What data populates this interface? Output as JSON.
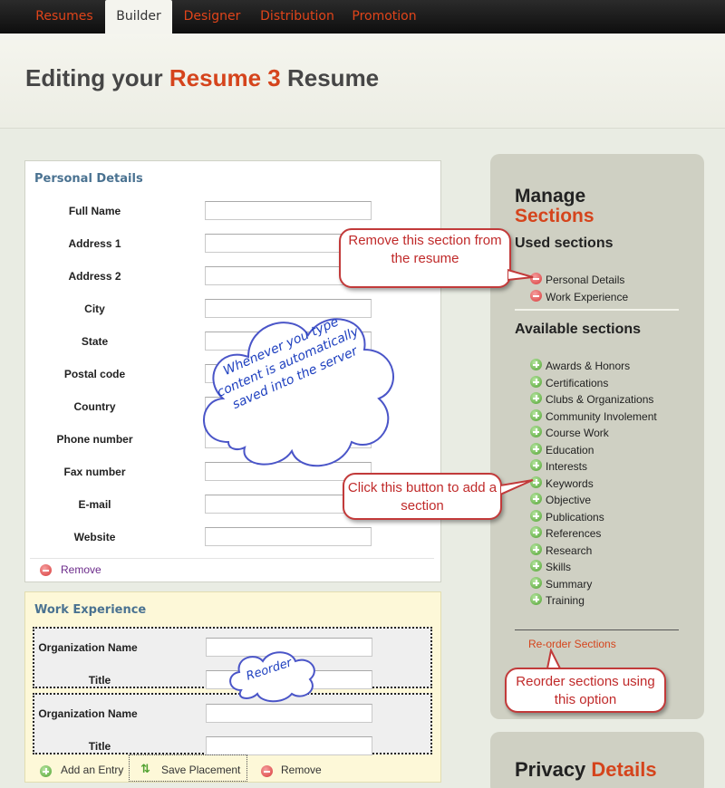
{
  "nav": {
    "tabs": [
      "Resumes",
      "Builder",
      "Designer",
      "Distribution",
      "Promotion"
    ],
    "active": "Builder"
  },
  "header": {
    "prefix": "Editing your",
    "resume_name": "Resume 3",
    "suffix": "Resume"
  },
  "personal": {
    "title": "Personal Details",
    "fields": [
      "Full Name",
      "Address 1",
      "Address 2",
      "City",
      "State",
      "Postal code",
      "Country",
      "Phone number",
      "Fax number",
      "E-mail",
      "Website"
    ],
    "remove_label": "Remove"
  },
  "work": {
    "title": "Work Experience",
    "entry_fields": [
      "Organization Name",
      "Title"
    ],
    "add_label": "Add an Entry",
    "save_label": "Save Placement",
    "remove_label": "Remove"
  },
  "sidebar": {
    "heading_line1": "Manage",
    "heading_line2": "Sections",
    "used_title": "Used sections",
    "used": [
      "Personal Details",
      "Work Experience"
    ],
    "available_title": "Available sections",
    "available": [
      "Awards & Honors",
      "Certifications",
      "Clubs & Organizations",
      "Community Involement",
      "Course Work",
      "Education",
      "Interests",
      "Keywords",
      "Objective",
      "Publications",
      "References",
      "Research",
      "Skills",
      "Summary",
      "Training"
    ],
    "reorder_label": "Re-order Sections",
    "privacy_word1": "Privacy",
    "privacy_word2": "Details"
  },
  "callouts": {
    "remove": "Remove this section from the resume",
    "add": "Click this button to add a section",
    "reorder": "Reorder sections using this option",
    "cloud_autosave": "Whenever you type content is automatically saved into the server",
    "cloud_reorder": "Reorder"
  },
  "colors": {
    "accent": "#d5441c",
    "panel_title": "#4a7291",
    "callout_border": "#c23a3a",
    "cloud_text": "#1d3fbf"
  }
}
